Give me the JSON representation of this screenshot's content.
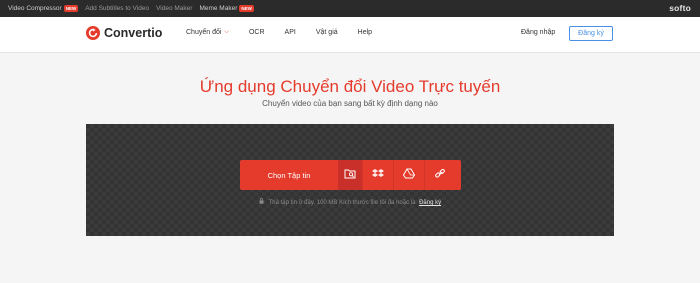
{
  "topbar": {
    "links": [
      {
        "label": "Video Compressor",
        "badge": "NEW"
      },
      {
        "label": "Add Subtitles to Video",
        "badge": ""
      },
      {
        "label": "Video Maker",
        "badge": ""
      },
      {
        "label": "Meme Maker",
        "badge": "NEW"
      }
    ],
    "brand": "softo"
  },
  "header": {
    "logo_text": "Convertio",
    "nav": [
      {
        "label": "Chuyển đổi",
        "dropdown": true
      },
      {
        "label": "OCR",
        "dropdown": false
      },
      {
        "label": "API",
        "dropdown": false
      },
      {
        "label": "Vật giá",
        "dropdown": false
      },
      {
        "label": "Help",
        "dropdown": false
      }
    ],
    "login": "Đăng nhập",
    "signup": "Đăng ký"
  },
  "hero": {
    "title": "Ứng dụng Chuyển đổi Video Trực tuyến",
    "subtitle": "Chuyển video của bạn sang bất kỳ định dạng nào"
  },
  "upload": {
    "choose_label": "Chọn Tập tin",
    "icons": [
      "folder-search-icon",
      "dropbox-icon",
      "google-drive-icon",
      "url-link-icon"
    ],
    "hint_text": "Thả tập tin ở đây. 100 MB Kích thước file tối đa hoặc là",
    "hint_link": "Đăng ký"
  },
  "colors": {
    "accent": "#e53b2c",
    "topbar": "#2b2b2b",
    "dropzone": "#333333",
    "signup_border": "#4a90e2"
  }
}
